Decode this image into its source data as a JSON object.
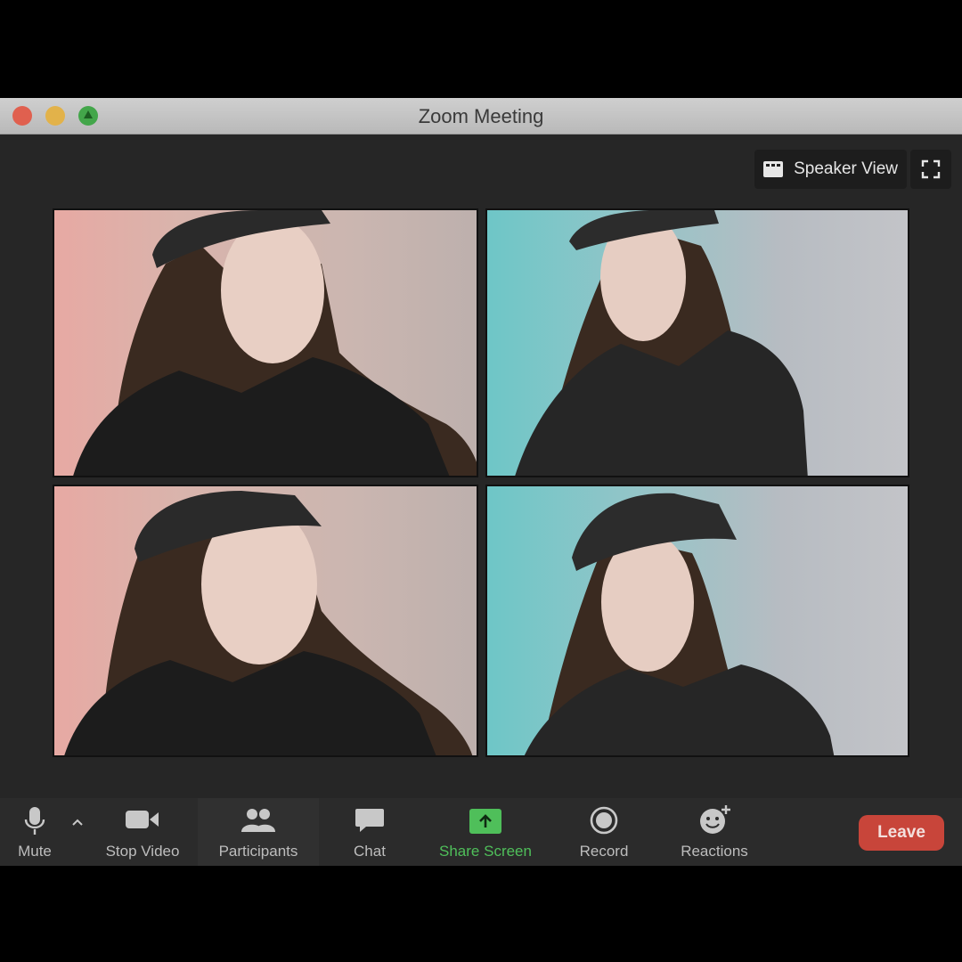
{
  "window": {
    "title": "Zoom Meeting"
  },
  "view_controls": {
    "speaker_view_label": "Speaker View"
  },
  "toolbar": {
    "mute_label": "Mute",
    "stop_video_label": "Stop Video",
    "participants_label": "Participants",
    "chat_label": "Chat",
    "share_screen_label": "Share Screen",
    "record_label": "Record",
    "reactions_label": "Reactions",
    "leave_label": "Leave"
  },
  "colors": {
    "share_screen_accent": "#4fbf5a",
    "leave_button": "#c8453a"
  },
  "video_tiles": [
    {
      "background": "pink"
    },
    {
      "background": "teal"
    },
    {
      "background": "pink"
    },
    {
      "background": "teal"
    }
  ]
}
